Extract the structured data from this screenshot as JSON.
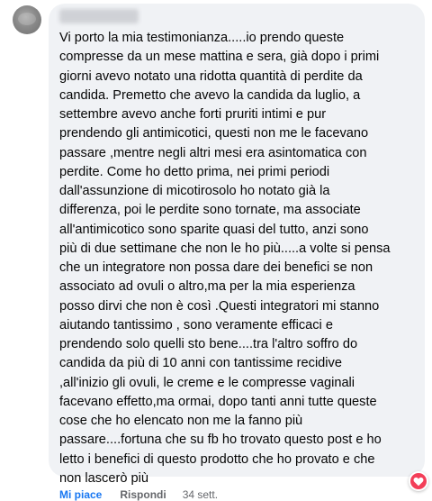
{
  "comment": {
    "text": "Vi porto la mia testimonianza.....io prendo queste\ncompresse da un mese mattina e sera, già dopo i primi\ngiorni avevo notato una ridotta quantità di perdite da\ncandida. Premetto che avevo la candida da luglio, a\nsettembre avevo anche forti pruriti intimi e pur\nprendendo gli antimicotici, questi non me le facevano\npassare ,mentre negli altri mesi era asintomatica con\nperdite. Come ho detto prima, nei primi periodi\ndall'assunzione di micotirosolo ho notato già la\ndifferenza, poi le perdite sono tornate, ma associate\nall'antimicotico sono sparite quasi del tutto, anzi sono\npiù di due settimane che non le ho più.....a volte si pensa\nche un integratore non possa dare dei benefici se non\nassociato ad ovuli o altro,ma per la mia esperienza\nposso dirvi che non è così .Questi integratori mi stanno\naiutando tantissimo , sono veramente efficaci e\nprendendo solo quelli sto bene....tra l'altro soffro do\ncandida da più di 10 anni con tantissime recidive\n,all'inizio gli ovuli, le creme e le compresse vaginali\nfacevano effetto,ma ormai, dopo tanti anni tutte queste\ncose che ho elencato non me la fanno più\npassare....fortuna che su fb ho trovato questo post e ho\nletto i benefici di questo prodotto che ho provato e che\nnon lascerò più",
    "reaction_icon": "heart-icon"
  },
  "actions": {
    "like_label": "Mi piace",
    "reply_label": "Rispondi",
    "timestamp": "34 sett."
  },
  "colors": {
    "bubble_bg": "#f0f2f5",
    "text": "#050505",
    "like_blue": "#1877f2",
    "meta_gray": "#65676b",
    "heart_red": "#f33e58"
  }
}
